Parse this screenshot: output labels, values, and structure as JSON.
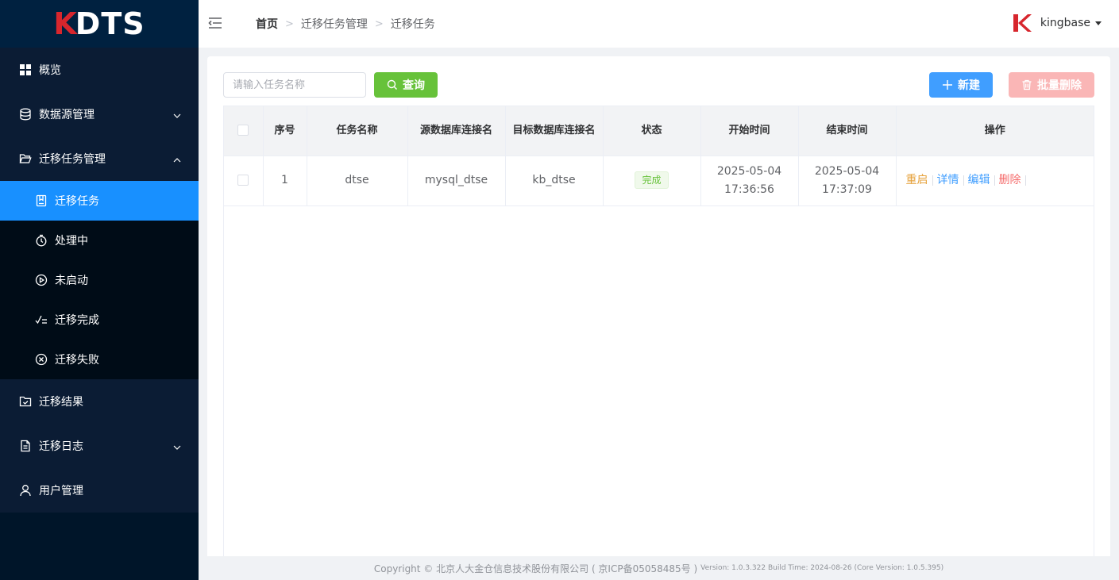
{
  "app": {
    "logo_k": "K",
    "logo_rest": "DTS"
  },
  "sidebar": {
    "items": [
      {
        "label": "概览",
        "icon": "grid-icon"
      },
      {
        "label": "数据源管理",
        "icon": "database-icon",
        "expanded": false
      },
      {
        "label": "迁移任务管理",
        "icon": "folder-open-icon",
        "expanded": true
      },
      {
        "label": "迁移结果",
        "icon": "folder-check-icon"
      },
      {
        "label": "迁移日志",
        "icon": "document-icon",
        "expanded": false
      },
      {
        "label": "用户管理",
        "icon": "user-icon"
      }
    ],
    "subitems": [
      {
        "label": "迁移任务",
        "icon": "notebook-icon",
        "active": true
      },
      {
        "label": "处理中",
        "icon": "stopwatch-icon"
      },
      {
        "label": "未启动",
        "icon": "play-circle-icon"
      },
      {
        "label": "迁移完成",
        "icon": "check-list-icon"
      },
      {
        "label": "迁移失败",
        "icon": "x-circle-icon"
      }
    ]
  },
  "header": {
    "breadcrumb": [
      "首页",
      "迁移任务管理",
      "迁移任务"
    ],
    "username": "kingbase"
  },
  "toolbar": {
    "search_placeholder": "请输入任务名称",
    "search_label": "查询",
    "new_label": "新建",
    "batch_delete_label": "批量删除"
  },
  "table": {
    "columns": [
      "序号",
      "任务名称",
      "源数据库连接名",
      "目标数据库连接名",
      "状态",
      "开始时间",
      "结束时间",
      "操作"
    ],
    "rows": [
      {
        "index": "1",
        "name": "dtse",
        "source": "mysql_dtse",
        "target": "kb_dtse",
        "status": "完成",
        "start": "2025-05-04 17:36:56",
        "end": "2025-05-04 17:37:09",
        "actions": [
          "重启",
          "详情",
          "编辑",
          "删除"
        ]
      }
    ]
  },
  "footer": {
    "copyright": "Copyright © 北京人大金仓信息技术股份有限公司 ( 京ICP备05058485号 )",
    "version": "Version: 1.0.3.322 Build Time: 2024-08-26 (Core Version: 1.0.5.395)"
  },
  "colors": {
    "sidebar_bg": "#001529",
    "active": "#1890ff",
    "search_btn": "#67c23a",
    "new_btn": "#409eff",
    "batch_delete_btn": "#fab6b6",
    "brand_red": "#d7262d"
  }
}
